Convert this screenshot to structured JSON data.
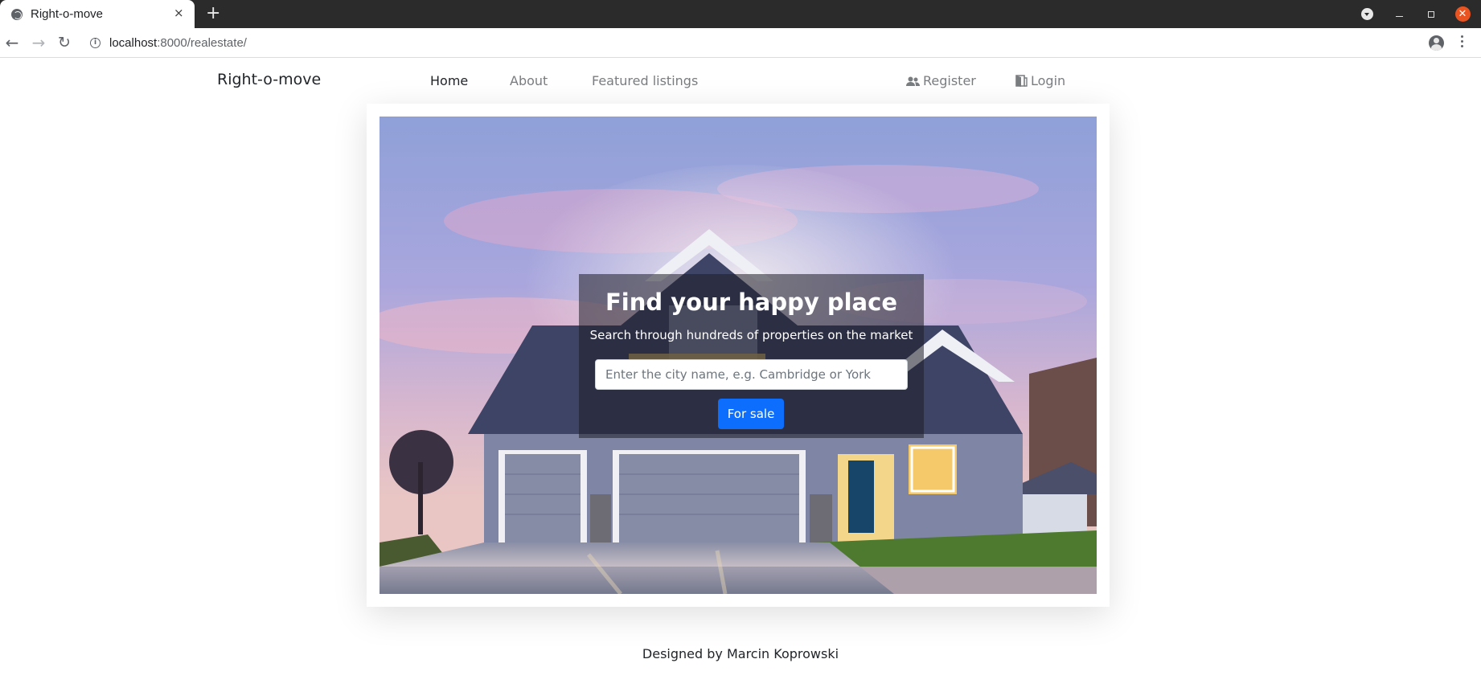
{
  "browser": {
    "tab_title": "Right-o-move",
    "tab_close": "×",
    "new_tab": "+",
    "url_host": "localhost",
    "url_rest": ":8000/realestate/",
    "close_glyph": "✕",
    "back_glyph": "←",
    "forward_glyph": "→",
    "reload_glyph": "↻",
    "star_glyph": "☆",
    "info_glyph": "i"
  },
  "nav": {
    "brand": "Right-o-move",
    "links": {
      "home": "Home",
      "about": "About",
      "featured": "Featured listings",
      "register": "Register",
      "login": "Login"
    }
  },
  "hero": {
    "title": "Find your happy place",
    "subtitle": "Search through hundreds of properties on the market",
    "search_placeholder": "Enter the city name, e.g. Cambridge or York",
    "search_value": "",
    "button_label": "For sale"
  },
  "footer": {
    "credit": "Designed by Marcin Koprowski"
  },
  "colors": {
    "primary_button": "#0d6efd",
    "active_link": "#212529",
    "muted_link": "#7a7d80"
  },
  "icons": {
    "register": "users-icon",
    "login": "door-icon"
  }
}
